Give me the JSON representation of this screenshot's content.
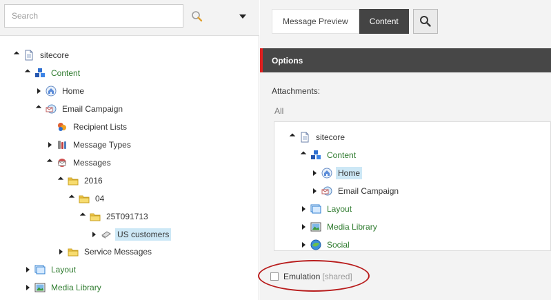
{
  "search": {
    "placeholder": "Search"
  },
  "left_tree": [
    {
      "label": "sitecore",
      "toggle": "down",
      "icon": "page-icon",
      "color": "dark"
    },
    {
      "label": "Content",
      "toggle": "down",
      "icon": "content-cubes-icon",
      "color": "green"
    },
    {
      "label": "Home",
      "toggle": "right",
      "icon": "home-icon",
      "color": "dark"
    },
    {
      "label": "Email Campaign",
      "toggle": "down",
      "icon": "email-campaign-icon",
      "color": "dark"
    },
    {
      "label": "Recipient Lists",
      "toggle": "none",
      "icon": "recipient-lists-icon",
      "color": "dark"
    },
    {
      "label": "Message Types",
      "toggle": "right",
      "icon": "message-types-icon",
      "color": "dark"
    },
    {
      "label": "Messages",
      "toggle": "down",
      "icon": "messages-icon",
      "color": "dark"
    },
    {
      "label": "2016",
      "toggle": "down",
      "icon": "folder-icon",
      "color": "dark"
    },
    {
      "label": "04",
      "toggle": "down",
      "icon": "folder-icon",
      "color": "dark"
    },
    {
      "label": "25T091713",
      "toggle": "down",
      "icon": "folder-icon",
      "color": "dark"
    },
    {
      "label": "US customers",
      "toggle": "right",
      "icon": "message-item-icon",
      "color": "dark",
      "selected": true
    },
    {
      "label": "Service Messages",
      "toggle": "right",
      "icon": "folder-icon",
      "color": "dark"
    },
    {
      "label": "Layout",
      "toggle": "right",
      "icon": "layout-icon",
      "color": "green"
    },
    {
      "label": "Media Library",
      "toggle": "right",
      "icon": "media-library-icon",
      "color": "green"
    }
  ],
  "tabs": {
    "message_preview": "Message Preview",
    "content": "Content",
    "search_icon": "search-icon"
  },
  "options": {
    "title": "Options"
  },
  "attachments": {
    "label": "Attachments:",
    "filter": "All",
    "tree": [
      {
        "label": "sitecore",
        "toggle": "down",
        "icon": "page-icon",
        "color": "dark"
      },
      {
        "label": "Content",
        "toggle": "down",
        "icon": "content-cubes-icon",
        "color": "green"
      },
      {
        "label": "Home",
        "toggle": "right",
        "icon": "home-icon",
        "color": "dark",
        "selected": true
      },
      {
        "label": "Email Campaign",
        "toggle": "right",
        "icon": "email-campaign-icon",
        "color": "dark"
      },
      {
        "label": "Layout",
        "toggle": "right",
        "icon": "layout-icon",
        "color": "green"
      },
      {
        "label": "Media Library",
        "toggle": "right",
        "icon": "media-library-icon",
        "color": "green"
      },
      {
        "label": "Social",
        "toggle": "right",
        "icon": "social-icon",
        "color": "green"
      }
    ]
  },
  "emulation": {
    "label": "Emulation",
    "shared": "[shared]",
    "checked": false
  },
  "colors": {
    "accent": "#e02020",
    "tree_green": "#2d7a2d",
    "selected_bg": "#cde8f6",
    "highlight": "#b81c1c"
  }
}
